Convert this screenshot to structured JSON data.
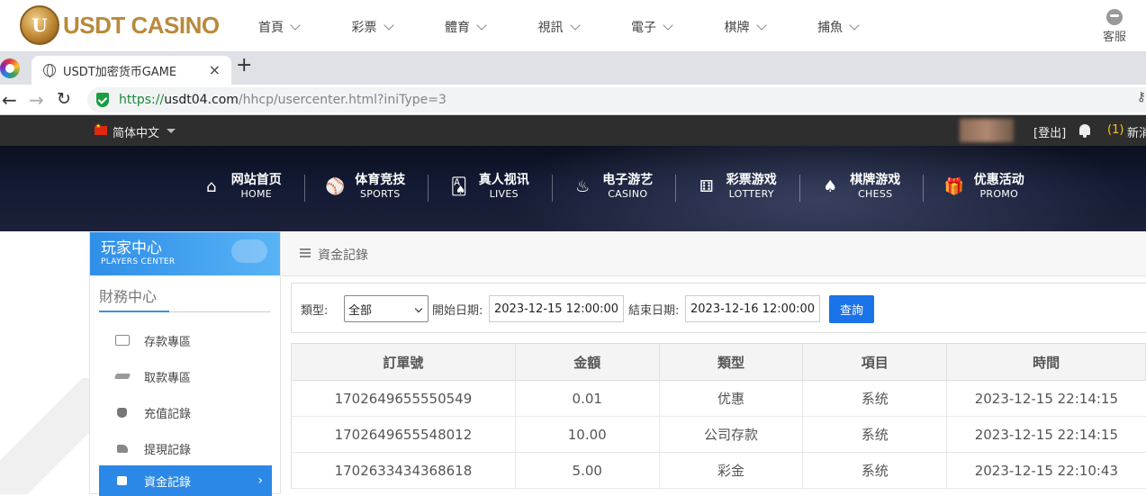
{
  "site": {
    "logo_letter": "U",
    "logo_text": "USDT CASINO",
    "menu": [
      "首頁",
      "彩票",
      "體育",
      "視訊",
      "電子",
      "棋牌",
      "捕魚"
    ],
    "service_label": "客服"
  },
  "browser": {
    "tab_title": "USDT加密货币GAME",
    "tab_close": "×",
    "new_tab": "+",
    "url_scheme": "https://",
    "url_host": "usdt04.com",
    "url_path": "/hhcp/usercenter.html?iniType=3"
  },
  "header": {
    "language": "简体中文",
    "logout": "[登出]",
    "message_count": "(1)",
    "message_label": "新消息"
  },
  "categories": [
    {
      "cn": "网站首页",
      "en": "HOME",
      "icon": "⌂"
    },
    {
      "cn": "体育竞技",
      "en": "SPORTS",
      "icon": "⚾"
    },
    {
      "cn": "真人视讯",
      "en": "LIVES",
      "icon": "🂡"
    },
    {
      "cn": "电子游艺",
      "en": "CASINO",
      "icon": "♨"
    },
    {
      "cn": "彩票游戏",
      "en": "LOTTERY",
      "icon": "⚅"
    },
    {
      "cn": "棋牌游戏",
      "en": "CHESS",
      "icon": "♠"
    },
    {
      "cn": "优惠活动",
      "en": "PROMO",
      "icon": "🎁"
    }
  ],
  "sidebar": {
    "title": "玩家中心",
    "subtitle": "PLAYERS CENTER",
    "section": "財務中心",
    "items": [
      {
        "label": "存款專區"
      },
      {
        "label": "取款專區"
      },
      {
        "label": "充值記錄"
      },
      {
        "label": "提現記錄"
      },
      {
        "label": "資金記錄",
        "arrow": "›"
      }
    ]
  },
  "panel": {
    "title": "資金記錄"
  },
  "filter": {
    "type_label": "類型:",
    "type_value": "全部",
    "start_label": "開始日期:",
    "start_value": "2023-12-15 12:00:00",
    "end_label": "結束日期:",
    "end_value": "2023-12-16 12:00:00",
    "query_label": "查詢"
  },
  "table": {
    "headers": [
      "訂單號",
      "金額",
      "類型",
      "項目",
      "時間"
    ],
    "rows": [
      [
        "1702649655550549",
        "0.01",
        "优惠",
        "系统",
        "2023-12-15 22:14:15"
      ],
      [
        "1702649655548012",
        "10.00",
        "公司存款",
        "系统",
        "2023-12-15 22:14:15"
      ],
      [
        "1702633434368618",
        "5.00",
        "彩金",
        "系统",
        "2023-12-15 22:10:43"
      ]
    ]
  }
}
